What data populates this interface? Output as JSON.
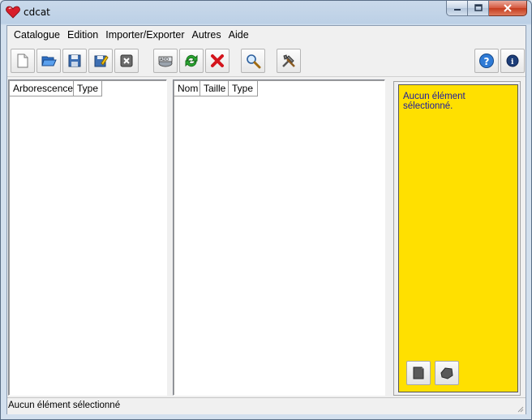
{
  "window": {
    "title": "cdcat"
  },
  "menu": [
    "Catalogue",
    "Edition",
    "Importer/Exporter",
    "Autres",
    "Aide"
  ],
  "tree_panel": {
    "columns": [
      "Arborescence",
      "Type"
    ]
  },
  "list_panel": {
    "columns": [
      "Nom",
      "Taille",
      "Type"
    ]
  },
  "info_panel": {
    "text": "Aucun élément sélectionné.",
    "background": "#ffe000"
  },
  "statusbar": {
    "text": "Aucun élément sélectionné"
  },
  "toolbar": {
    "icons": [
      "new-document-icon",
      "open-folder-icon",
      "save-icon",
      "save-as-icon",
      "close-catalog-icon",
      "add-media-icon",
      "rescan-icon",
      "delete-icon",
      "search-icon",
      "settings-tools-icon",
      "help-icon",
      "about-info-icon"
    ]
  }
}
